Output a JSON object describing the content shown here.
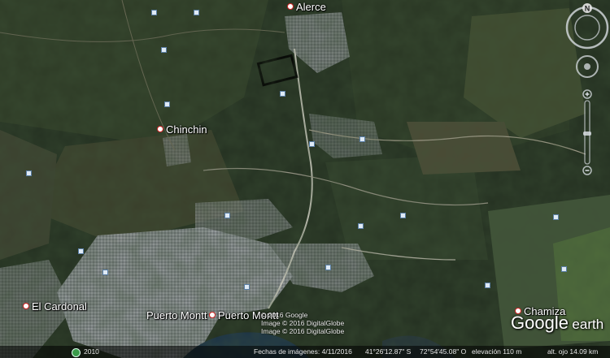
{
  "places": {
    "alerce": "Alerce",
    "chinchin": "Chinchin",
    "el_cardonal": "El Cardonal",
    "puerto_montt": "Puerto Montt",
    "puerto_montt_2": "Puerto Montt",
    "chamiza": "Chamiza"
  },
  "copyright": {
    "line1": "© 2016 Google",
    "line2": "Image © 2016 DigitalGlobe",
    "line3": "Image © 2016 DigitalGlobe"
  },
  "statusbar": {
    "history_year": "2010",
    "imagery_date": "Fechas de imágenes: 4/11/2016",
    "latitude": "41°26'12.87\" S",
    "longitude": "72°54'45.08\" O",
    "elevation": "elevación   110 m",
    "eye_altitude": "alt. ojo  14.09 km"
  },
  "logo": {
    "google": "Google",
    "earth": "earth"
  },
  "navigation": {
    "north_label": "N"
  },
  "colors": {
    "vegetation_dark": "#1f2a1c",
    "urban": "#8b8f95",
    "sea": "#1c3347",
    "place_dot": "#cc2222",
    "poi_icon": "#dfeaf5"
  }
}
